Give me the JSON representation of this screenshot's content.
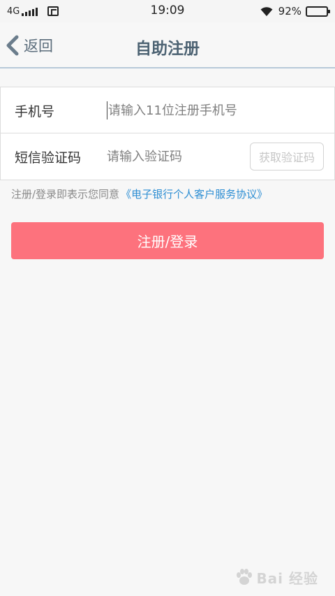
{
  "status_bar": {
    "network": "4G",
    "time": "19:09",
    "battery": "92%",
    "battery_level": 0.92,
    "icons": [
      "signal-icon",
      "screenshot-icon",
      "wifi-icon",
      "battery-icon"
    ]
  },
  "nav": {
    "back_label": "返回",
    "title": "自助注册"
  },
  "form": {
    "phone_label": "手机号",
    "phone_placeholder": "请输入11位注册手机号",
    "phone_value": "",
    "code_label": "短信验证码",
    "code_placeholder": "请输入验证码",
    "code_value": "",
    "get_code_label": "获取验证码"
  },
  "agreement": {
    "text": "注册/登录即表示您同意",
    "link": "《电子银行个人客户服务协议》"
  },
  "submit_label": "注册/登录",
  "watermark": {
    "text": "Bai 经验",
    "icon": "baidu-paw-icon"
  },
  "colors": {
    "primary_button": "#fd727d",
    "link": "#2d8ed3",
    "title": "#4d6373",
    "nav_divider": "#b7c9d9",
    "background": "#f7f7f7"
  }
}
